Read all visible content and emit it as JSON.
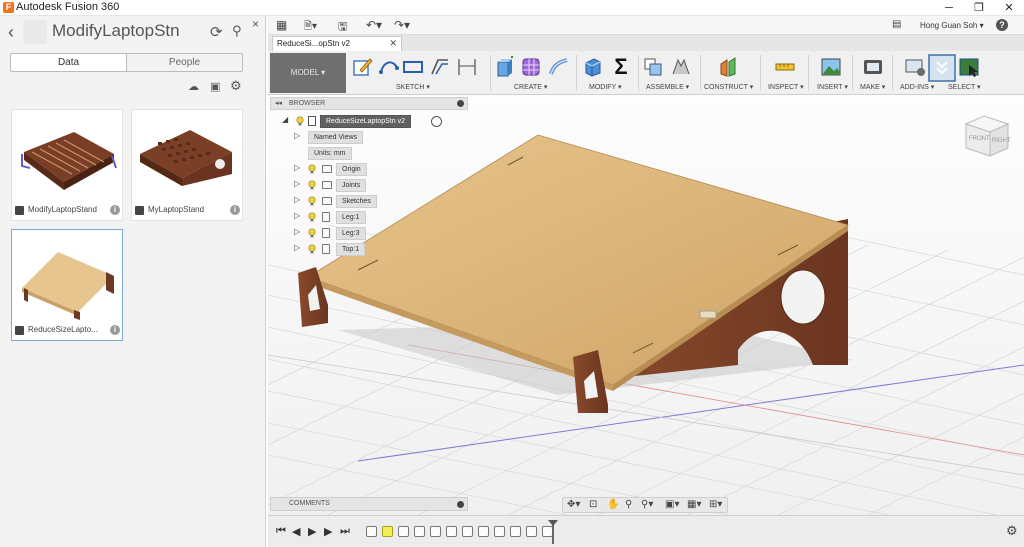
{
  "window": {
    "title": "Autodesk Fusion 360",
    "minimize": "─",
    "restore": "❐",
    "close": "✕"
  },
  "data_panel": {
    "back": "‹",
    "project_title": "ModifyLaptopStn",
    "refresh_icon": "⟳",
    "search_icon": "⚲",
    "close": "×",
    "tabs": {
      "data": "Data",
      "people": "People"
    },
    "tools": {
      "upload": "☁",
      "new_folder": "▣",
      "settings": "⚙"
    },
    "designs": [
      {
        "name": "ModifyLaptopStand",
        "info": "i"
      },
      {
        "name": "MyLaptopStand",
        "info": "i"
      },
      {
        "name": "ReduceSizeLapto...",
        "info": "i"
      }
    ]
  },
  "quick_access": {
    "grid_icon": "▦",
    "file_icon": "🗎▾",
    "save_icon": "🖫",
    "undo_icon": "↶▾",
    "redo_icon": "↷▾",
    "chat_icon": "▤",
    "user_name": "Hong Guan Soh ▾",
    "help": "?"
  },
  "document_tab": {
    "title": "ReduceSi...opStn v2",
    "close": "✕"
  },
  "ribbon": {
    "workspace": "MODEL ▾",
    "groups": [
      "SKETCH ▾",
      "CREATE ▾",
      "MODIFY ▾",
      "ASSEMBLE ▾",
      "CONSTRUCT ▾",
      "INSPECT ▾",
      "INSERT ▾",
      "MAKE ▾",
      "ADD-INS ▾",
      "SELECT ▾"
    ]
  },
  "browser": {
    "header": "BROWSER",
    "collapse": "◂◂",
    "root": "ReduceSizeLaptopStn v2",
    "nodes": [
      {
        "label": "Named Views",
        "arrow": "▷",
        "bulb": false,
        "folder": true
      },
      {
        "label": "Units: mm",
        "arrow": "",
        "bulb": false,
        "folder": false
      },
      {
        "label": "Origin",
        "arrow": "▷",
        "bulb": true,
        "folder": true
      },
      {
        "label": "Joints",
        "arrow": "▷",
        "bulb": true,
        "folder": true
      },
      {
        "label": "Sketches",
        "arrow": "▷",
        "bulb": true,
        "folder": true
      },
      {
        "label": "Leg:1",
        "arrow": "▷",
        "bulb": true,
        "folder": false
      },
      {
        "label": "Leg:3",
        "arrow": "▷",
        "bulb": true,
        "folder": false
      },
      {
        "label": "Top:1",
        "arrow": "▷",
        "bulb": true,
        "folder": false
      }
    ]
  },
  "viewcube": {
    "front": "FRONT",
    "right": "RIGHT"
  },
  "comments": {
    "label": "COMMENTS"
  },
  "navbar": {
    "orbit": "✥▾",
    "look": "⊡",
    "pan": "✋",
    "zoom": "⚲",
    "fit": "⚲▾",
    "display": "▣▾",
    "grid": "▦▾",
    "viewports": "⊞▾"
  },
  "timeline": {
    "first": "⏮",
    "prev": "◀",
    "play": "▶",
    "next": "▶",
    "last": "⏭",
    "settings": "⚙",
    "feature_count": 12
  }
}
